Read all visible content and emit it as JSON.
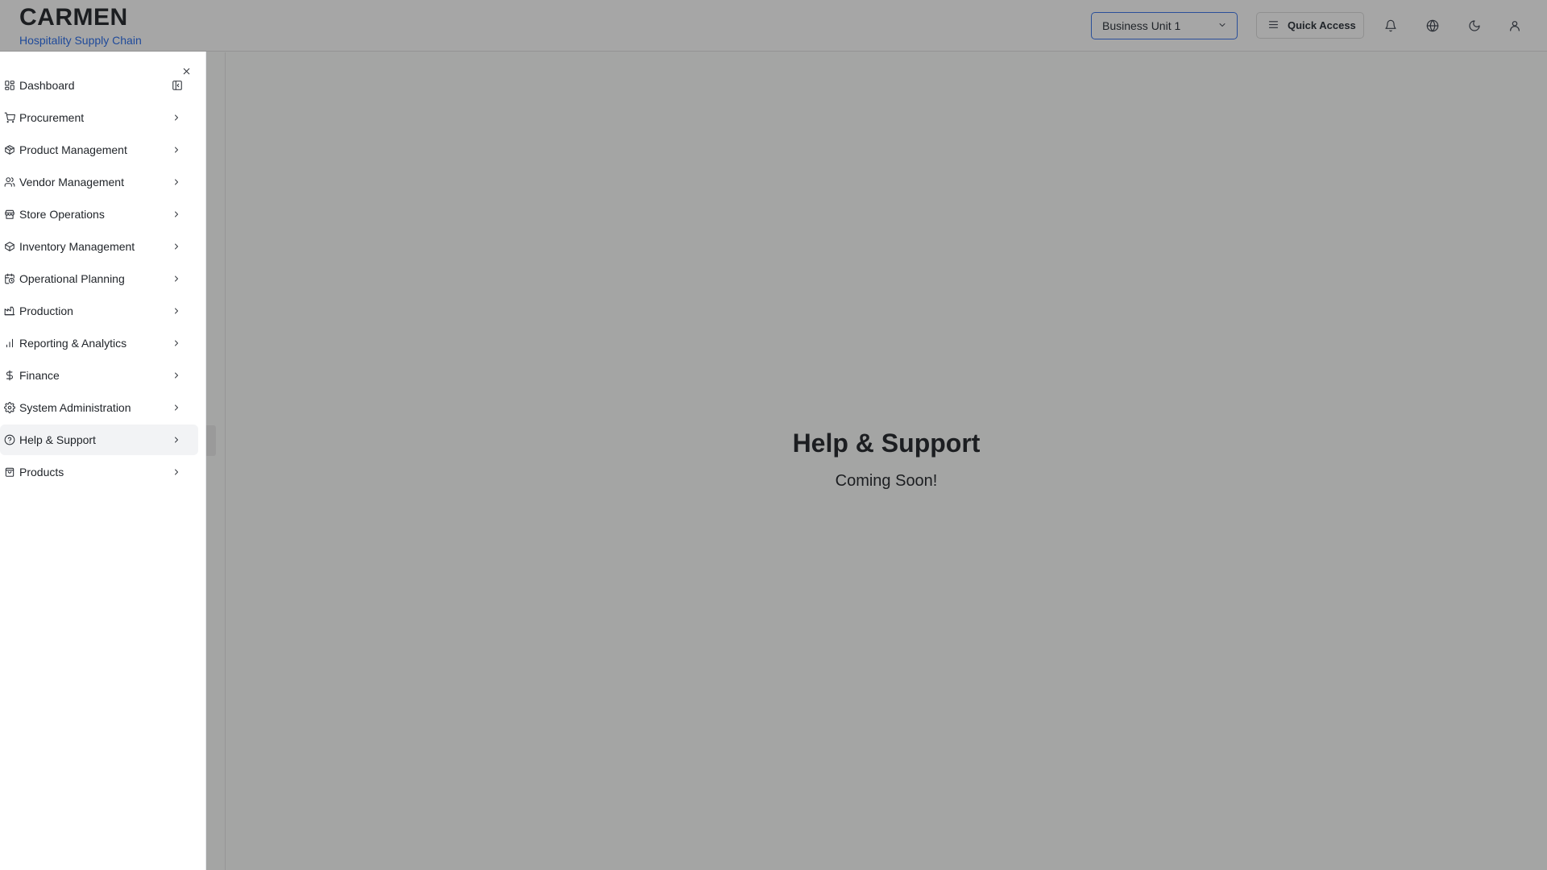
{
  "header": {
    "brand_title": "CARMEN",
    "brand_subtitle": "Hospitality Supply Chain",
    "business_unit": {
      "selected": "Business Unit 1"
    },
    "quick_access_label": "Quick Access",
    "icons": [
      "bell-icon",
      "globe-icon",
      "moon-icon",
      "user-icon"
    ]
  },
  "sidebar": {
    "items": [
      {
        "label": "Dashboard",
        "icon": "dashboard-icon"
      },
      {
        "label": "Procurement",
        "icon": "cart-icon"
      },
      {
        "label": "Product Management",
        "icon": "package-icon"
      },
      {
        "label": "Vendor Management",
        "icon": "users-icon"
      },
      {
        "label": "Store Operations",
        "icon": "store-icon"
      },
      {
        "label": "Inventory Management",
        "icon": "box-icon"
      },
      {
        "label": "Operational Planning",
        "icon": "calendar-clock-icon"
      },
      {
        "label": "Production",
        "icon": "factory-icon"
      },
      {
        "label": "Reporting & Analytics",
        "icon": "bar-chart-icon"
      },
      {
        "label": "Finance",
        "icon": "dollar-icon"
      },
      {
        "label": "System Administration",
        "icon": "gear-icon"
      },
      {
        "label": "Help & Support",
        "icon": "help-circle-icon",
        "active": true
      },
      {
        "label": "Products",
        "icon": "shopping-bag-icon"
      }
    ]
  },
  "main": {
    "title": "Help & Support",
    "subtitle": "Coming Soon!"
  }
}
